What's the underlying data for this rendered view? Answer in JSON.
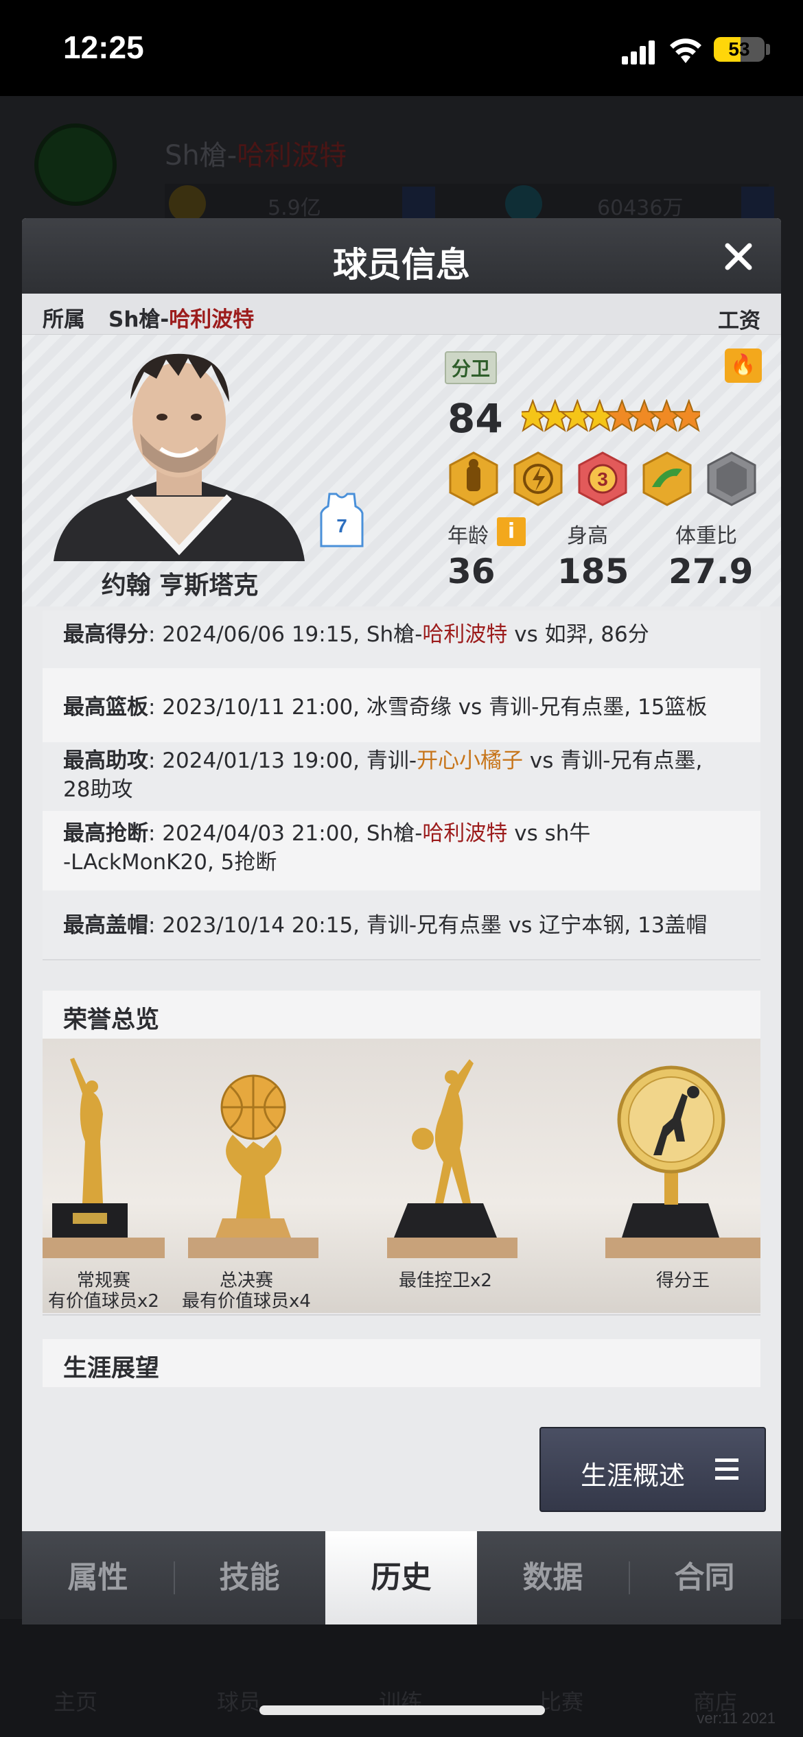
{
  "status_bar": {
    "time": "12:25",
    "battery": "53",
    "battery_level": 0.53
  },
  "background": {
    "team_prefix": "Sh槍-",
    "team_name": "哈利波特",
    "bar_text_1": "5.9亿",
    "bar_text_2": "60436万"
  },
  "modal": {
    "title": "球员信息"
  },
  "team_bar": {
    "label": "所属",
    "team_prefix": "Sh槍-",
    "team_name": "哈利波特",
    "salary_label": "工资"
  },
  "player": {
    "name": "约翰 亨斯塔克",
    "jersey_number": "7",
    "position": "分卫",
    "overall": "84",
    "star_rating": {
      "gold": 4,
      "orange": 4
    },
    "traits": [
      "defender-badge",
      "lightning-badge",
      "three-point-badge",
      "speed-badge",
      "locked-badge"
    ],
    "stats": [
      {
        "label": "年龄",
        "value": "36"
      },
      {
        "label": "身高",
        "value": "185"
      },
      {
        "label": "体重比",
        "value": "27.9"
      }
    ]
  },
  "records": [
    {
      "label": "最高得分",
      "pre": ": 2024/06/06 19:15, Sh槍-",
      "hl": "哈利波特",
      "hl_color": "red",
      "post": " vs 如羿, 86分"
    },
    {
      "label": "最高篮板",
      "pre": ": 2023/10/11 21:00, 冰雪奇缘 vs 青训-兄有点墨, 15篮板",
      "hl": "",
      "hl_color": "",
      "post": ""
    },
    {
      "label": "最高助攻",
      "pre": ": 2024/01/13 19:00, 青训-",
      "hl": "开心小橘子",
      "hl_color": "orange",
      "post": " vs 青训-兄有点墨,",
      "line2": " 28助攻"
    },
    {
      "label": "最高抢断",
      "pre": ": 2024/04/03 21:00, Sh槍-",
      "hl": "哈利波特",
      "hl_color": "red",
      "post": " vs sh牛",
      "line2": "-LAckMonK20, 5抢断"
    },
    {
      "label": "最高盖帽",
      "pre": ": 2023/10/14 20:15, 青训-兄有点墨 vs 辽宁本钢, 13盖帽",
      "hl": "",
      "hl_color": "",
      "post": ""
    }
  ],
  "honors": {
    "title": "荣誉总览",
    "items": [
      {
        "line1": "常规赛",
        "line2": "有价值球员x2",
        "icon": "mvp-statue-trophy"
      },
      {
        "line1": "总决赛",
        "line2": "最有价值球员x4",
        "icon": "basketball-trophy"
      },
      {
        "line1": "最佳控卫x2",
        "line2": "",
        "icon": "dribbler-trophy"
      },
      {
        "line1": "得分王",
        "line2": "",
        "icon": "gold-medal-trophy"
      }
    ]
  },
  "career": {
    "title": "生涯展望",
    "button_label": "生涯概述"
  },
  "tabs": [
    {
      "label": "属性",
      "active": false
    },
    {
      "label": "技能",
      "active": false
    },
    {
      "label": "历史",
      "active": true
    },
    {
      "label": "数据",
      "active": false
    },
    {
      "label": "合同",
      "active": false
    }
  ],
  "background_nav": [
    "主页",
    "球员",
    "训练",
    "比赛",
    "商店"
  ],
  "version": "ver:11   2021",
  "colors": {
    "accent_red": "#9c1c1c",
    "accent_orange": "#c7751a",
    "gold": "#f3a81c",
    "header_dark": "#2e3034"
  }
}
